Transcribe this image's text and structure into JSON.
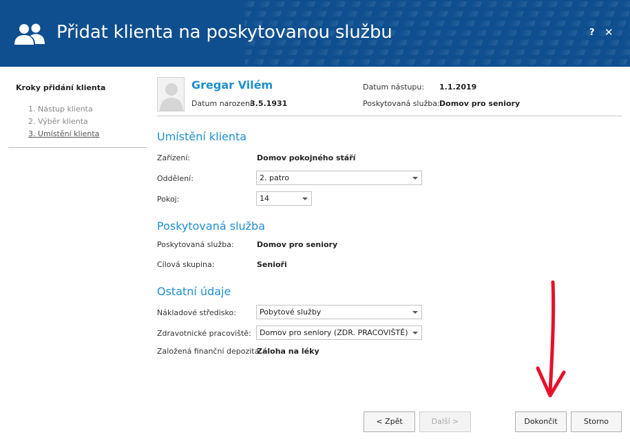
{
  "header": {
    "title": "Přidat klienta na poskytovanou službu",
    "help_label": "?",
    "close_label": "✕",
    "bg_color": "#0f4f8f",
    "logo_icon": "users-icon"
  },
  "sidebar": {
    "title": "Kroky přidání klienta",
    "steps": [
      {
        "label": "1. Nástup klienta"
      },
      {
        "label": "2. Výběr klienta"
      },
      {
        "label": "3. Umístění klienta"
      }
    ]
  },
  "client": {
    "name": "Gregar Vilém",
    "birth_label": "Datum narození:",
    "birth_value": "3.5.1931",
    "start_label": "Datum nástupu:",
    "start_value": "1.1.2019",
    "service_label": "Poskytovaná služba:",
    "service_value": "Domov pro seniory"
  },
  "placement": {
    "heading": "Umístění klienta",
    "facility_label": "Zařízení:",
    "facility_value": "Domov pokojného stáří",
    "department_label": "Oddělení:",
    "department_value": "2. patro",
    "room_label": "Pokoj:",
    "room_value": "14"
  },
  "service": {
    "heading": "Poskytovaná služba",
    "service_label": "Poskytovaná služba:",
    "service_value": "Domov pro seniory",
    "target_label": "Cílová skupina:",
    "target_value": "Senioři"
  },
  "other": {
    "heading": "Ostatní údaje",
    "cost_center_label": "Nákladové středisko:",
    "cost_center_value": "Pobytové služby",
    "health_label": "Zdravotnické pracoviště:",
    "health_value": "Domov pro seniory (ZDR. PRACOVIŠTĚ)",
    "deposit_label": "Založená finanční depozita:",
    "deposit_value": "Záloha na léky"
  },
  "buttons": {
    "back": "< Zpět",
    "next": "Další >",
    "finish": "Dokončit",
    "cancel": "Storno"
  },
  "colors": {
    "accent": "#1f8fcf",
    "annotation_arrow": "#e8102a"
  }
}
